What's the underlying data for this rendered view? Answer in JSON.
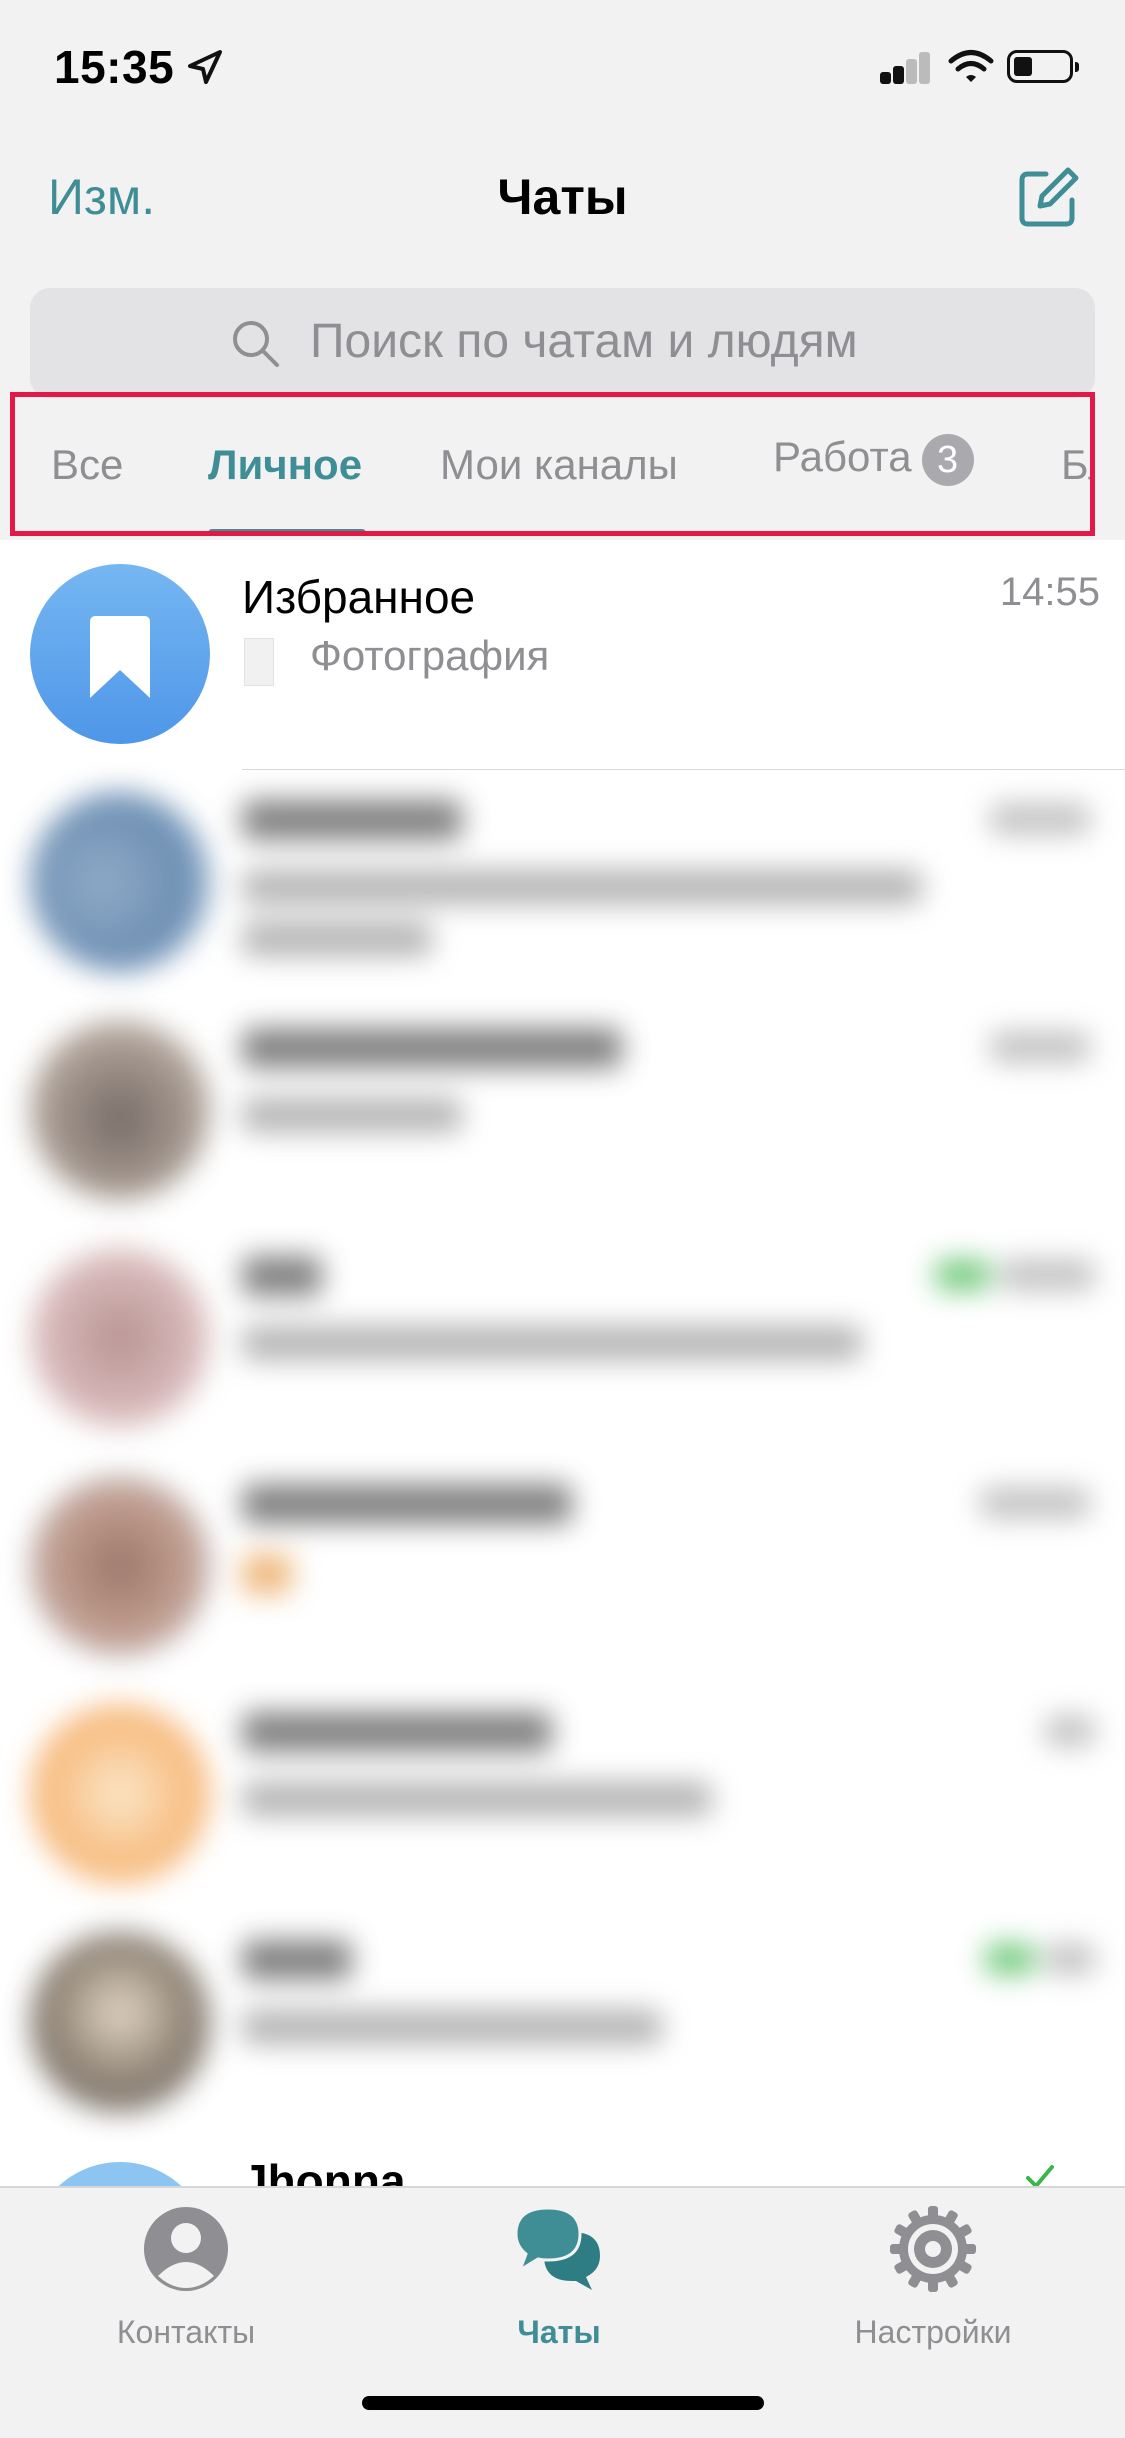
{
  "status_bar": {
    "time": "15:35"
  },
  "header": {
    "edit_label": "Изм.",
    "title": "Чаты",
    "compose_icon": "compose-icon"
  },
  "search": {
    "placeholder": "Поиск по чатам и людям"
  },
  "folders": {
    "tabs": [
      {
        "label": "Все",
        "active": false
      },
      {
        "label": "Личное",
        "active": true
      },
      {
        "label": "Мои каналы",
        "active": false
      },
      {
        "label": "Работа",
        "active": false,
        "badge": "3"
      },
      {
        "label": "Бло",
        "active": false
      }
    ]
  },
  "chats": {
    "favorites": {
      "name": "Избранное",
      "time": "14:55",
      "message": "Фотография"
    },
    "partial_name": "Jhonna"
  },
  "tabbar": {
    "items": [
      {
        "label": "Контакты",
        "icon": "person-icon",
        "active": false
      },
      {
        "label": "Чаты",
        "icon": "chat-bubbles-icon",
        "active": true
      },
      {
        "label": "Настройки",
        "icon": "gear-icon",
        "active": false
      }
    ]
  },
  "colors": {
    "accent": "#3f8e95",
    "highlight_frame": "#e31846",
    "favorites_avatar": "#5aa6ee"
  }
}
